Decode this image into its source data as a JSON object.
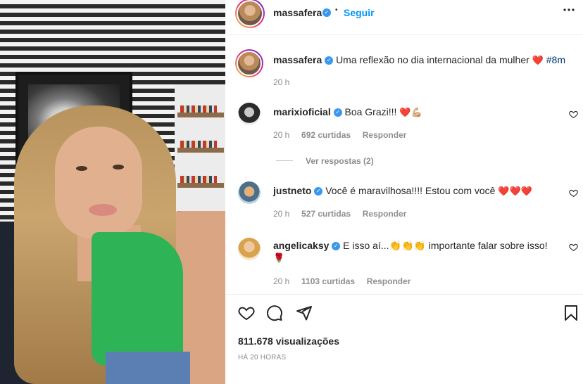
{
  "post": {
    "author": "massafera",
    "follow_label": "Seguir",
    "separator": "•",
    "more_label": "•••",
    "caption_text": "Uma reflexão no dia internacional da mulher",
    "caption_emoji": "❤️",
    "caption_hashtag": "#8m",
    "caption_time": "20 h",
    "views": "811.678 visualizações",
    "posted_ago": "HÁ 20 HORAS"
  },
  "comments": [
    {
      "user": "marixioficial",
      "text": "Boa Grazi!!!",
      "emoji": "❤️💪🏼",
      "time": "20 h",
      "likes": "692 curtidas",
      "reply_label": "Responder",
      "view_replies": "Ver respostas (2)"
    },
    {
      "user": "justneto",
      "text": "Você é maravilhosa!!!! Estou com você",
      "emoji": "❤️❤️❤️",
      "time": "20 h",
      "likes": "527 curtidas",
      "reply_label": "Responder"
    },
    {
      "user": "angelicaksy",
      "text_before": "E isso aí...",
      "emoji_mid": "👏👏👏",
      "text_after": "importante falar sobre isso!",
      "emoji_line2": "🌹",
      "time": "20 h",
      "likes": "1103 curtidas",
      "reply_label": "Responder"
    }
  ],
  "icons": {
    "verified": "verified-badge-icon",
    "like": "heart-outline-icon",
    "comment": "comment-bubble-icon",
    "share": "paper-plane-icon",
    "save": "bookmark-icon"
  },
  "colors": {
    "accent": "#0095f6",
    "verified": "#3897f0",
    "muted": "#8e8e8e",
    "text": "#262626"
  }
}
